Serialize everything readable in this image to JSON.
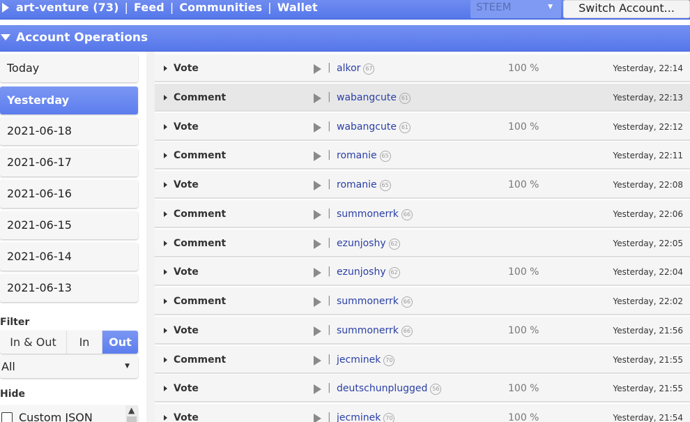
{
  "topbar": {
    "account": "art-venture (73)",
    "links": [
      "Feed",
      "Communities",
      "Wallet"
    ],
    "chain": "STEEM",
    "switch_label": "Switch Account..."
  },
  "header": {
    "title": "Account Operations"
  },
  "sidebar": {
    "days": [
      "Today",
      "Yesterday",
      "2021-06-18",
      "2021-06-17",
      "2021-06-16",
      "2021-06-15",
      "2021-06-14",
      "2021-06-13"
    ],
    "active_day": "Yesterday",
    "filter_label": "Filter",
    "filter_options": [
      "In & Out",
      "In",
      "Out"
    ],
    "filter_selected": "Out",
    "type_select": "All",
    "hide_label": "Hide",
    "hide_items": [
      "Custom JSON"
    ]
  },
  "operations": [
    {
      "type": "Vote",
      "user": "alkor",
      "rep": "67",
      "pct": "100 %",
      "time": "Yesterday, 22:14"
    },
    {
      "type": "Comment",
      "user": "wabangcute",
      "rep": "61",
      "pct": "",
      "time": "Yesterday, 22:13"
    },
    {
      "type": "Vote",
      "user": "wabangcute",
      "rep": "61",
      "pct": "100 %",
      "time": "Yesterday, 22:12"
    },
    {
      "type": "Comment",
      "user": "romanie",
      "rep": "65",
      "pct": "",
      "time": "Yesterday, 22:11"
    },
    {
      "type": "Vote",
      "user": "romanie",
      "rep": "65",
      "pct": "100 %",
      "time": "Yesterday, 22:08"
    },
    {
      "type": "Comment",
      "user": "summonerrk",
      "rep": "66",
      "pct": "",
      "time": "Yesterday, 22:06"
    },
    {
      "type": "Comment",
      "user": "ezunjoshy",
      "rep": "62",
      "pct": "",
      "time": "Yesterday, 22:05"
    },
    {
      "type": "Vote",
      "user": "ezunjoshy",
      "rep": "62",
      "pct": "100 %",
      "time": "Yesterday, 22:04"
    },
    {
      "type": "Comment",
      "user": "summonerrk",
      "rep": "66",
      "pct": "",
      "time": "Yesterday, 22:02"
    },
    {
      "type": "Vote",
      "user": "summonerrk",
      "rep": "66",
      "pct": "100 %",
      "time": "Yesterday, 21:56"
    },
    {
      "type": "Comment",
      "user": "jecminek",
      "rep": "70",
      "pct": "",
      "time": "Yesterday, 21:55"
    },
    {
      "type": "Vote",
      "user": "deutschunplugged",
      "rep": "56",
      "pct": "100 %",
      "time": "Yesterday, 21:55"
    },
    {
      "type": "Vote",
      "user": "jecminek",
      "rep": "70",
      "pct": "100 %",
      "time": "Yesterday, 21:54"
    }
  ]
}
